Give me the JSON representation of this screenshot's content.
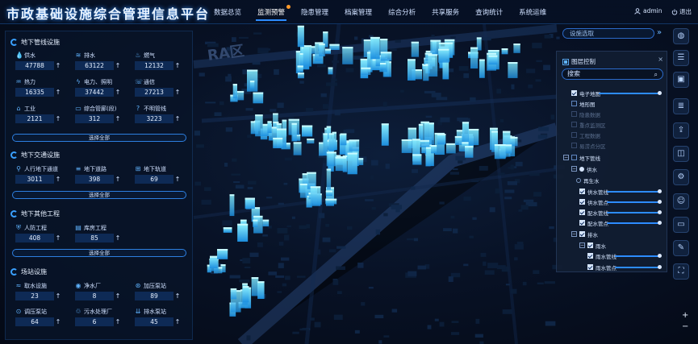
{
  "header": {
    "title": "市政基础设施综合管理信息平台",
    "nav": [
      "数据总览",
      "监测预警",
      "隐患管理",
      "档案管理",
      "综合分析",
      "共享服务",
      "查询统计",
      "系统运维"
    ],
    "user": "admin",
    "logout": "退出"
  },
  "map": {
    "label": "RA区"
  },
  "left_panel": {
    "sections": [
      {
        "title": "地下管线设施",
        "items": [
          {
            "label": "供水",
            "value": "47788",
            "icon": "droplet-icon"
          },
          {
            "label": "排水",
            "value": "63122",
            "icon": "drain-icon"
          },
          {
            "label": "燃气",
            "value": "12132",
            "icon": "flame-icon"
          },
          {
            "label": "热力",
            "value": "16335",
            "icon": "heat-icon"
          },
          {
            "label": "电力、照明",
            "value": "37442",
            "icon": "lightning-icon"
          },
          {
            "label": "通信",
            "value": "27213",
            "icon": "signal-icon"
          },
          {
            "label": "工业",
            "value": "2121",
            "icon": "factory-icon"
          },
          {
            "label": "综合管廊(段)",
            "value": "312",
            "icon": "tunnel-icon"
          },
          {
            "label": "不明管线",
            "value": "3223",
            "icon": "unknown-icon"
          }
        ],
        "button": "选择全部"
      },
      {
        "title": "地下交通设施",
        "items": [
          {
            "label": "人行地下通道",
            "value": "3011",
            "icon": "walk-icon"
          },
          {
            "label": "地下道路",
            "value": "398",
            "icon": "road-icon"
          },
          {
            "label": "地下轨道",
            "value": "69",
            "icon": "rail-icon"
          }
        ],
        "button": "选择全部"
      },
      {
        "title": "地下其他工程",
        "items": [
          {
            "label": "人防工程",
            "value": "408",
            "icon": "shelter-icon"
          },
          {
            "label": "库房工程",
            "value": "85",
            "icon": "warehouse-icon"
          }
        ],
        "button": "选择全部"
      },
      {
        "title": "场站设施",
        "items": [
          {
            "label": "取水设施",
            "value": "23",
            "icon": "intake-icon"
          },
          {
            "label": "净水厂",
            "value": "8",
            "icon": "plant-icon"
          },
          {
            "label": "加压泵站",
            "value": "89",
            "icon": "pump-icon"
          },
          {
            "label": "调压泵站",
            "value": "64",
            "icon": "regulator-icon"
          },
          {
            "label": "污水处理厂",
            "value": "6",
            "icon": "sewage-icon"
          },
          {
            "label": "排水泵站",
            "value": "45",
            "icon": "drainpump-icon"
          }
        ]
      }
    ],
    "arrow": "↑"
  },
  "right_panel": {
    "facility_placeholder": "设施选取",
    "layer_title": "图层控制",
    "search_placeholder": "搜索",
    "tree": [
      {
        "label": "电子地图",
        "checked": true
      },
      {
        "label": "地形图",
        "checked": false
      },
      {
        "label": "隐患数据",
        "dim": true
      },
      {
        "label": "重点监测区",
        "dim": true
      },
      {
        "label": "工程数据",
        "dim": true
      },
      {
        "label": "易涝点分区",
        "dim": true
      },
      {
        "label": "地下管线",
        "checked": false
      },
      {
        "label": "供水"
      },
      {
        "label": "再生水"
      },
      {
        "label": "供水管线",
        "checked": true
      },
      {
        "label": "供水管点",
        "checked": true
      },
      {
        "label": "配水管线",
        "checked": true
      },
      {
        "label": "配水管点",
        "checked": true
      },
      {
        "label": "排水",
        "checked": true
      },
      {
        "label": "雨水",
        "checked": true
      },
      {
        "label": "雨水管线",
        "checked": true
      },
      {
        "label": "雨水管点",
        "checked": true
      }
    ]
  },
  "toolbar": {
    "icons": [
      "globe-icon",
      "layers-icon",
      "briefcase-icon",
      "list-icon",
      "share-icon",
      "stack-icon",
      "gear-icon",
      "user-pin-icon",
      "chat-icon",
      "pen-icon",
      "fullscreen-icon"
    ],
    "zoom_in": "+",
    "zoom_out": "−"
  },
  "colors": {
    "accent": "#2d8cff",
    "building": "#33d6ff",
    "panel": "#08142a"
  }
}
